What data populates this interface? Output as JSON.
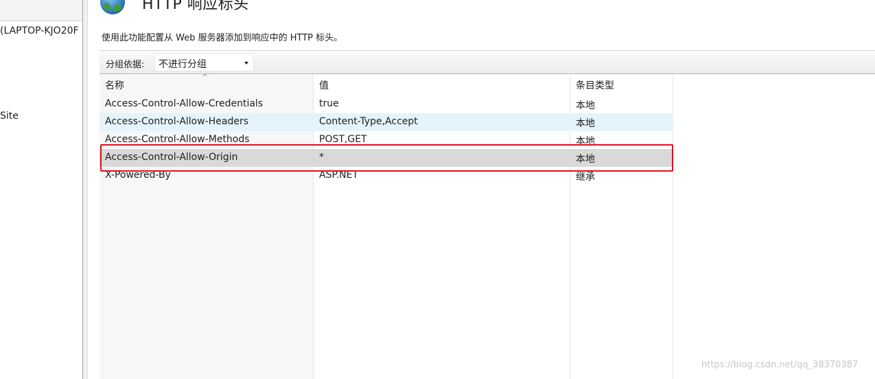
{
  "tree": {
    "items": [
      {
        "label": "(LAPTOP-KJO20F"
      },
      {
        "label": "Site"
      }
    ]
  },
  "header": {
    "icon": "globe-icon",
    "title": "HTTP 响应标头",
    "description": "使用此功能配置从 Web 服务器添加到响应中的 HTTP 标头。"
  },
  "toolbar": {
    "group_label": "分组依据:",
    "group_value": "不进行分组"
  },
  "table": {
    "columns": {
      "name": "名称",
      "value": "值",
      "type": "条目类型"
    },
    "sort_indicator": "^",
    "rows": [
      {
        "name": "Access-Control-Allow-Credentials",
        "value": "true",
        "type": "本地"
      },
      {
        "name": "Access-Control-Allow-Headers",
        "value": "Content-Type,Accept",
        "type": "本地"
      },
      {
        "name": "Access-Control-Allow-Methods",
        "value": "POST,GET",
        "type": "本地"
      },
      {
        "name": "Access-Control-Allow-Origin",
        "value": "*",
        "type": "本地"
      },
      {
        "name": "X-Powered-By",
        "value": "ASP.NET",
        "type": "继承"
      }
    ]
  },
  "colors": {
    "highlight": "#e0101b",
    "hover_row": "#e5f3fb",
    "selected_row": "#d9d9d9"
  },
  "watermark": "https://blog.csdn.net/qq_38370387"
}
